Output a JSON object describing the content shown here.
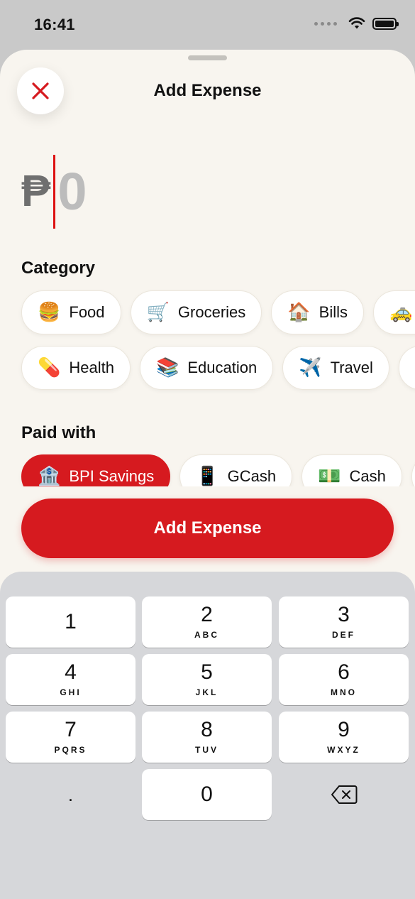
{
  "status_bar": {
    "time": "16:41"
  },
  "sheet": {
    "title": "Add Expense"
  },
  "amount": {
    "currency_symbol": "₱",
    "value": "0"
  },
  "category": {
    "label": "Category",
    "rows": [
      [
        {
          "emoji": "🍔",
          "label": "Food"
        },
        {
          "emoji": "🛒",
          "label": "Groceries"
        },
        {
          "emoji": "🏠",
          "label": "Bills"
        },
        {
          "emoji": "🚕",
          "label": ""
        }
      ],
      [
        {
          "emoji": "💊",
          "label": "Health"
        },
        {
          "emoji": "📚",
          "label": "Education"
        },
        {
          "emoji": "✈️",
          "label": "Travel"
        },
        {
          "emoji": "",
          "label": ""
        }
      ]
    ]
  },
  "paid_with": {
    "label": "Paid with",
    "selected_index": 0,
    "options": [
      {
        "emoji": "🏦",
        "label": "BPI Savings"
      },
      {
        "emoji": "📱",
        "label": "GCash"
      },
      {
        "emoji": "💵",
        "label": "Cash"
      },
      {
        "emoji": "",
        "label": ""
      }
    ]
  },
  "submit_label": "Add Expense",
  "keypad": {
    "keys": [
      {
        "digit": "1",
        "letters": ""
      },
      {
        "digit": "2",
        "letters": "ABC"
      },
      {
        "digit": "3",
        "letters": "DEF"
      },
      {
        "digit": "4",
        "letters": "GHI"
      },
      {
        "digit": "5",
        "letters": "JKL"
      },
      {
        "digit": "6",
        "letters": "MNO"
      },
      {
        "digit": "7",
        "letters": "PQRS"
      },
      {
        "digit": "8",
        "letters": "TUV"
      },
      {
        "digit": "9",
        "letters": "WXYZ"
      },
      {
        "digit": ".",
        "letters": ""
      },
      {
        "digit": "0",
        "letters": ""
      }
    ]
  },
  "colors": {
    "accent": "#d61a1f",
    "sheet_bg": "#f8f5ef",
    "keypad_bg": "#d6d7da"
  },
  "icons": {
    "close": "close-icon",
    "delete": "backspace-icon",
    "wifi": "wifi-icon",
    "battery": "battery-icon"
  }
}
